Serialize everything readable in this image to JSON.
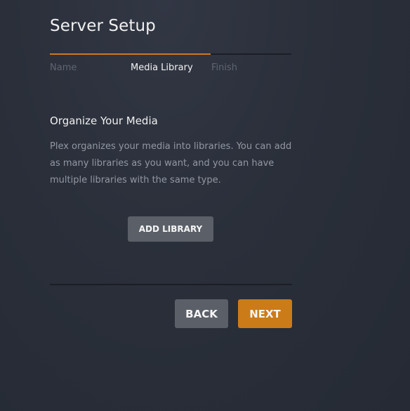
{
  "page": {
    "title": "Server Setup"
  },
  "steps": [
    {
      "label": "Name",
      "state": "completed"
    },
    {
      "label": "Media Library",
      "state": "active"
    },
    {
      "label": "Finish",
      "state": "upcoming"
    }
  ],
  "section": {
    "heading": "Organize Your Media",
    "description": "Plex organizes your media into libraries. You can add as many libraries as you want, and you can have multiple libraries with the same type."
  },
  "buttons": {
    "add_library": "ADD LIBRARY",
    "back": "BACK",
    "next": "NEXT"
  },
  "colors": {
    "accent": "#cc7b19",
    "button_secondary": "#5b6068",
    "background": "#2a2f3a"
  }
}
